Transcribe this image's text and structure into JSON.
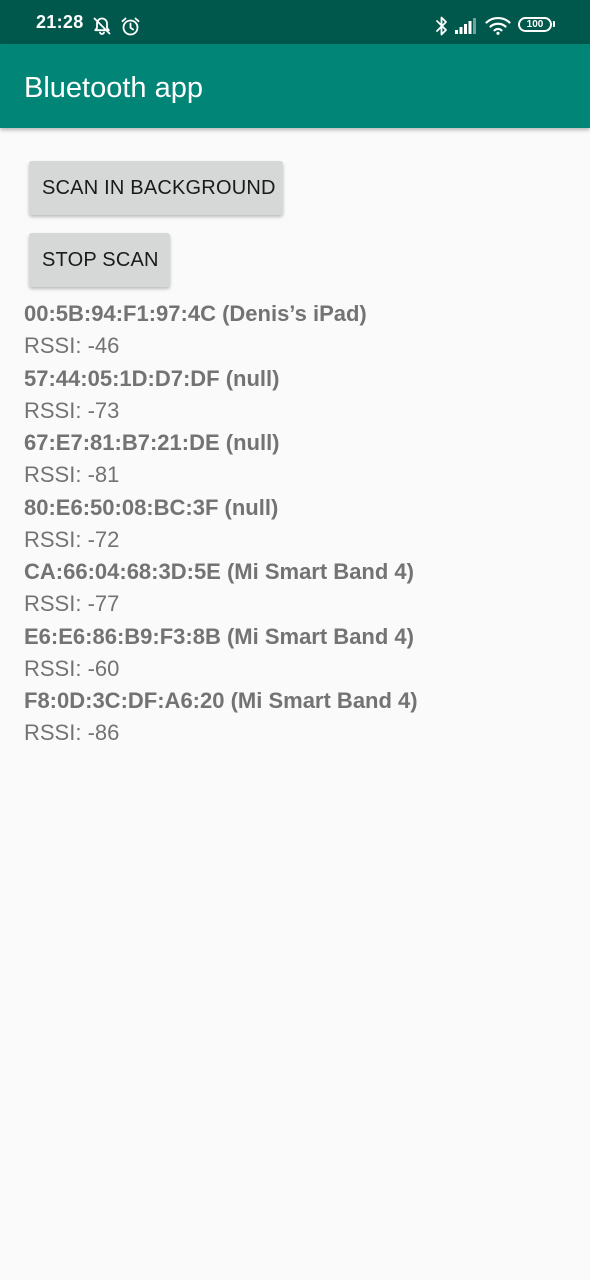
{
  "status_bar": {
    "time": "21:28",
    "left_icons": [
      "notifications-off-icon",
      "alarm-icon"
    ],
    "right_icons": [
      "bluetooth-icon",
      "cell-signal-icon",
      "wifi-icon"
    ],
    "battery": "100"
  },
  "app_bar": {
    "title": "Bluetooth app"
  },
  "buttons": {
    "scan_label": "SCAN IN BACKGROUND",
    "stop_label": "STOP SCAN"
  },
  "devices": [
    {
      "name": "00:5B:94:F1:97:4C (Denis’s iPad)",
      "rssi": "RSSI: -46"
    },
    {
      "name": "57:44:05:1D:D7:DF (null)",
      "rssi": "RSSI: -73"
    },
    {
      "name": "67:E7:81:B7:21:DE (null)",
      "rssi": "RSSI: -81"
    },
    {
      "name": "80:E6:50:08:BC:3F (null)",
      "rssi": "RSSI: -72"
    },
    {
      "name": "CA:66:04:68:3D:5E (Mi Smart Band 4)",
      "rssi": "RSSI: -77"
    },
    {
      "name": "E6:E6:86:B9:F3:8B (Mi Smart Band 4)",
      "rssi": "RSSI: -60"
    },
    {
      "name": "F8:0D:3C:DF:A6:20 (Mi Smart Band 4)",
      "rssi": "RSSI: -86"
    }
  ],
  "colors": {
    "status_bar": "#00574b",
    "app_bar": "#008577",
    "background": "#fafafa",
    "button": "#d6d7d7",
    "list_text": "#737373"
  }
}
